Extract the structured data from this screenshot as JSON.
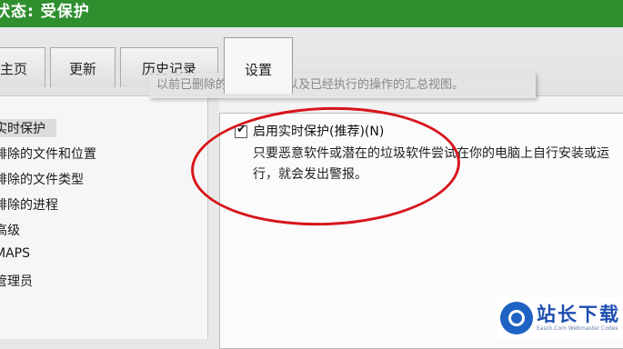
{
  "window": {
    "title": "状态: 受保护"
  },
  "tabs": [
    {
      "label": "主页"
    },
    {
      "label": "更新"
    },
    {
      "label": "历史记录"
    },
    {
      "label": "设置"
    }
  ],
  "tab_description": "以前已删除的检测到项目以及已经执行的操作的汇总视图。",
  "sidebar": {
    "items": [
      {
        "label": "实时保护"
      },
      {
        "label": "排除的文件和位置"
      },
      {
        "label": "排除的文件类型"
      },
      {
        "label": "排除的进程"
      },
      {
        "label": "高级"
      },
      {
        "label": "MAPS"
      },
      {
        "label": "管理员"
      }
    ]
  },
  "main": {
    "realtime_option": {
      "checked": true,
      "checkmark": "✔",
      "label": "启用实时保护(推荐)(N)",
      "description": "只要恶意软件或潜在的垃圾软件尝试在你的电脑上自行安装或运行，就会发出警报。"
    }
  },
  "annotation": {
    "color": "#d6161c"
  },
  "watermark": {
    "title": "站长下载",
    "subtitle": "Easck.Com Webmaster Codes"
  }
}
